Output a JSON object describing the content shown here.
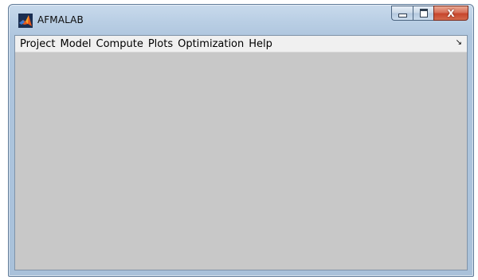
{
  "window": {
    "title": "AFMALAB",
    "icon": "matlab-logo-icon",
    "caption_buttons": {
      "minimize_icon": "minimize-icon",
      "maximize_icon": "maximize-icon",
      "close_icon": "close-icon",
      "close_glyph": "X"
    }
  },
  "menubar": {
    "items": [
      {
        "label": "Project"
      },
      {
        "label": "Model"
      },
      {
        "label": "Compute"
      },
      {
        "label": "Plots"
      },
      {
        "label": "Optimization"
      },
      {
        "label": "Help"
      }
    ],
    "overflow_glyph": "↘"
  },
  "colors": {
    "figure_background": "#c8c8c8",
    "menubar_background": "#f0f0f0",
    "frame_accent": "#b9cee4",
    "close_button": "#c7452c"
  }
}
